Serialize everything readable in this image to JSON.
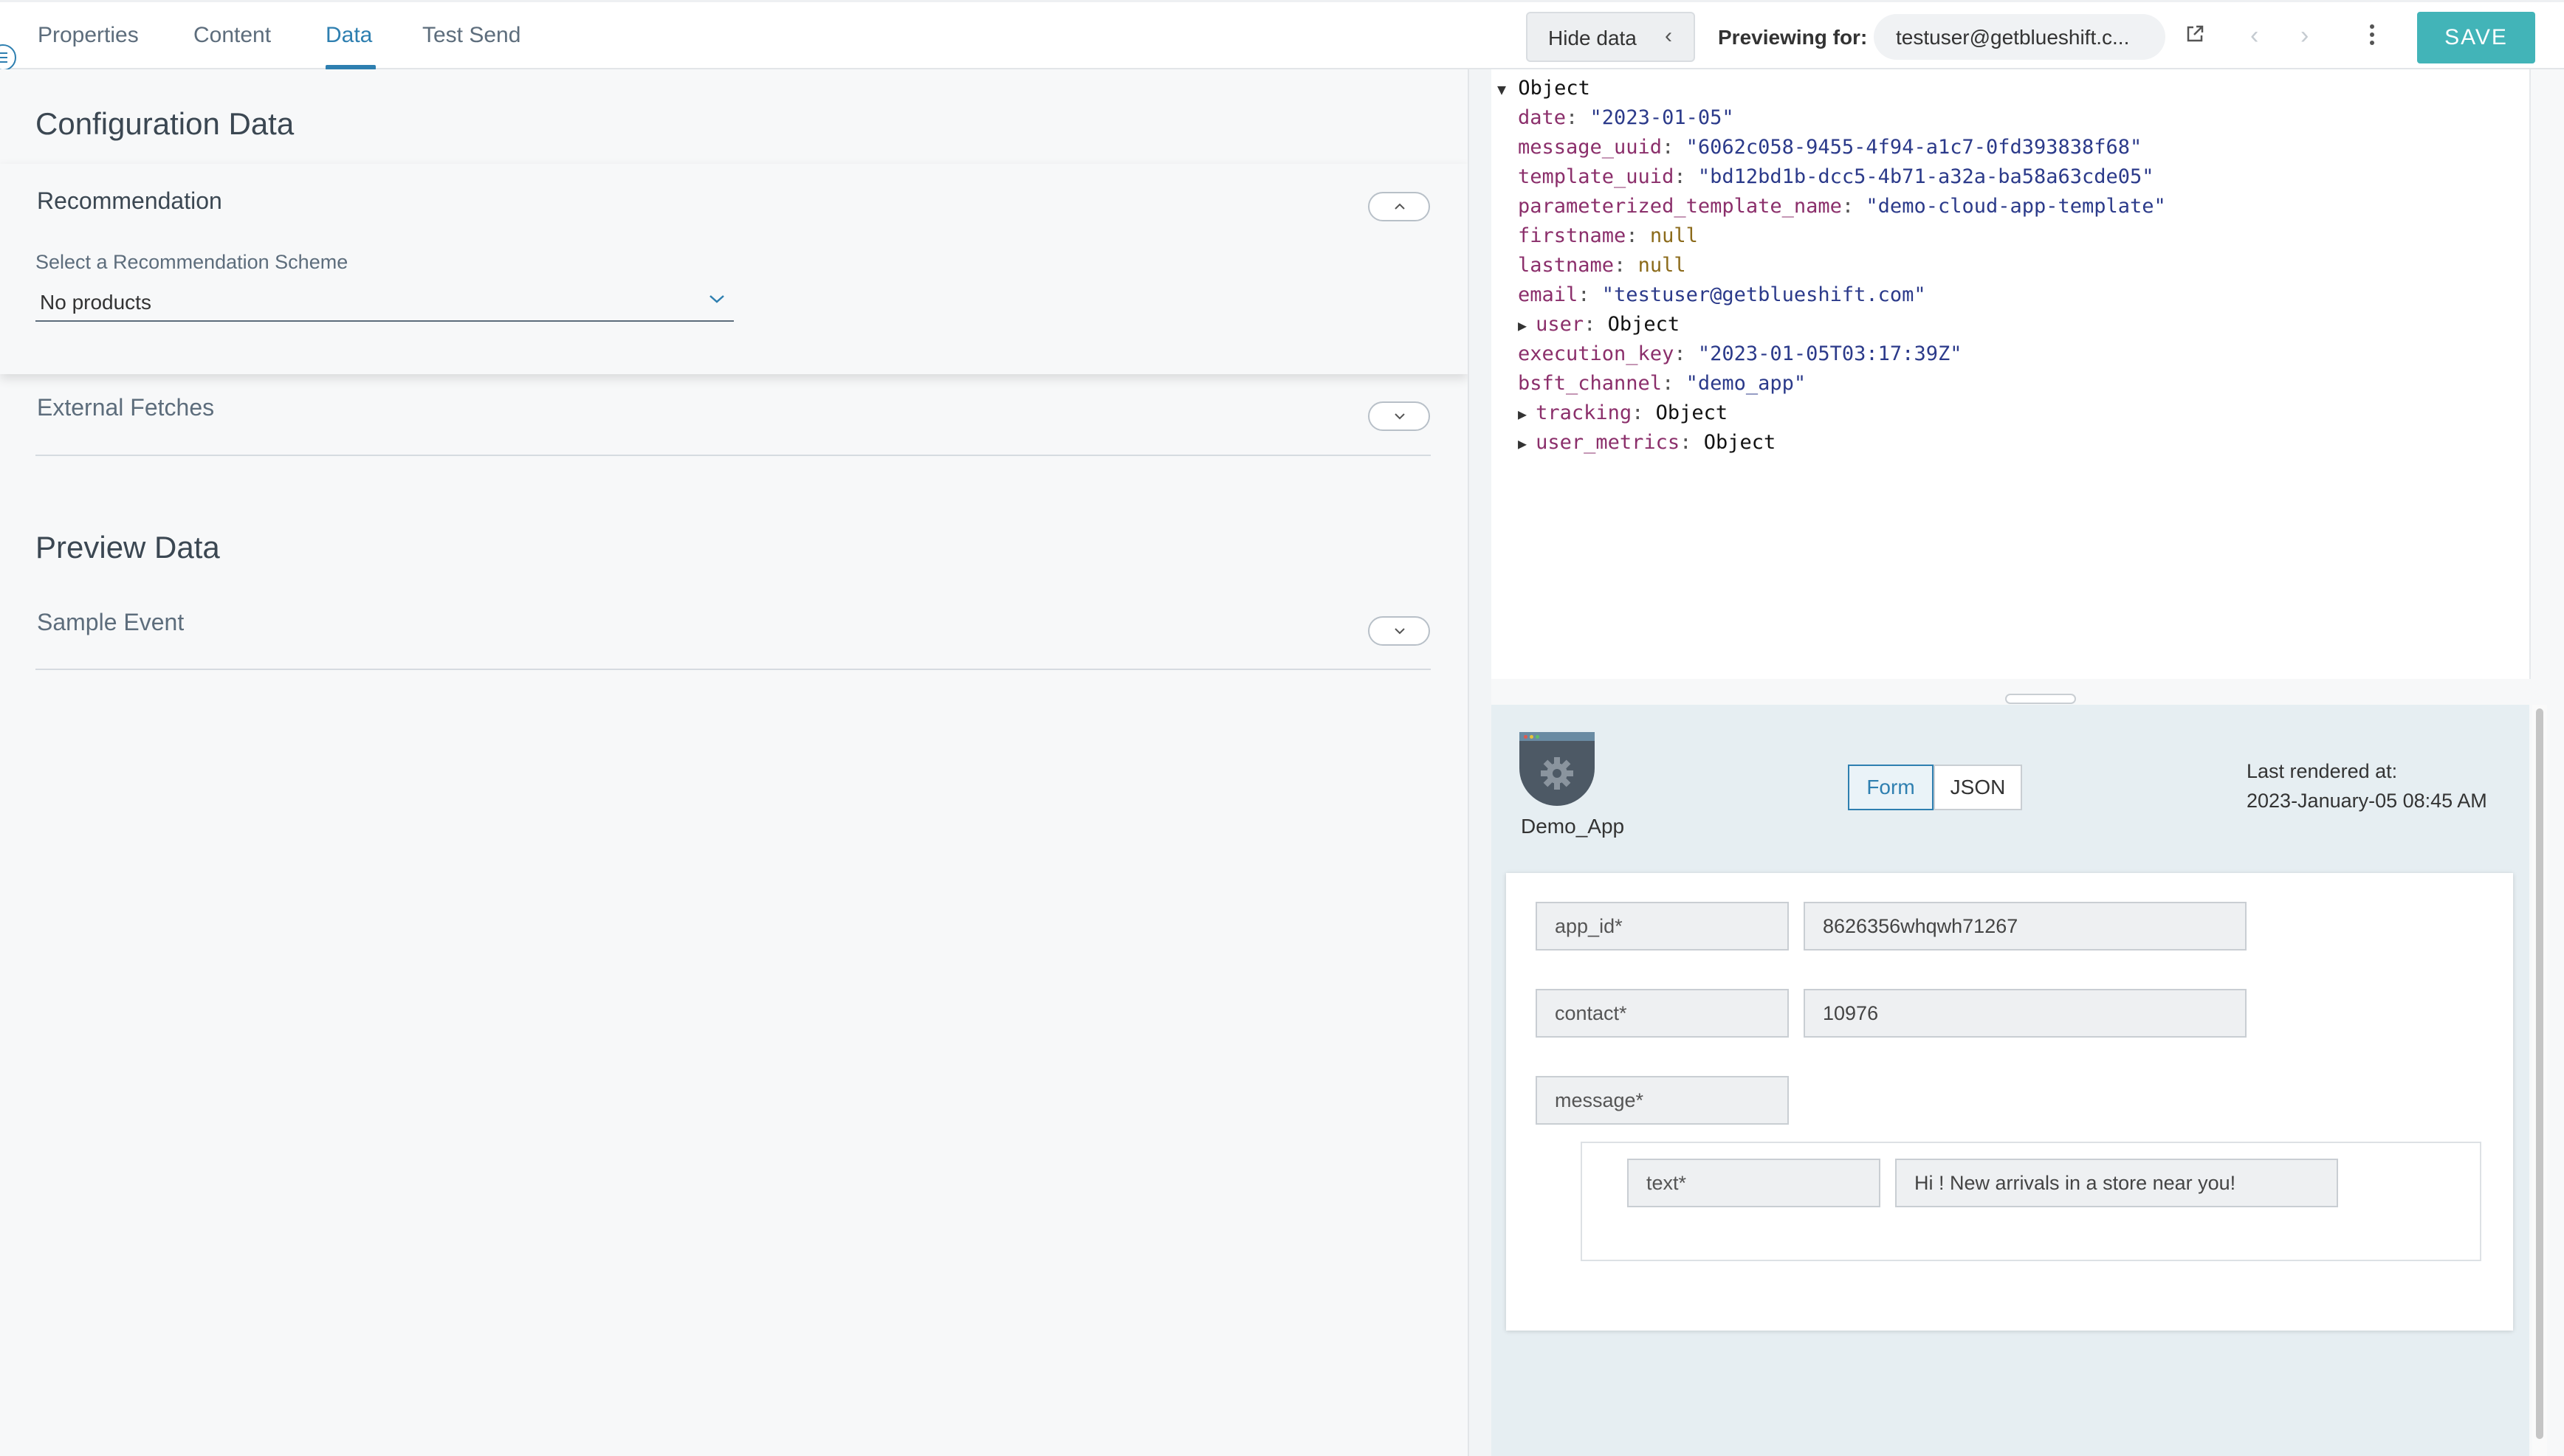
{
  "tabs": [
    {
      "label": "Properties"
    },
    {
      "label": "Content"
    },
    {
      "label": "Data"
    },
    {
      "label": "Test Send"
    }
  ],
  "header": {
    "hide_data_label": "Hide data",
    "previewing_label": "Previewing for:",
    "previewing_value": "testuser@getblueshift.c...",
    "save_label": "SAVE"
  },
  "left": {
    "config_title": "Configuration Data",
    "recommendation_title": "Recommendation",
    "scheme_label": "Select a Recommendation Scheme",
    "scheme_value": "No products",
    "external_fetches_title": "External Fetches",
    "preview_title": "Preview Data",
    "sample_event_title": "Sample Event"
  },
  "json_view": {
    "root": "Object",
    "lines": [
      {
        "key": "date",
        "value": "\"2023-01-05\"",
        "kind": "str"
      },
      {
        "key": "message_uuid",
        "value": "\"6062c058-9455-4f94-a1c7-0fd393838f68\"",
        "kind": "str"
      },
      {
        "key": "template_uuid",
        "value": "\"bd12bd1b-dcc5-4b71-a32a-ba58a63cde05\"",
        "kind": "str"
      },
      {
        "key": "parameterized_template_name",
        "value": "\"demo-cloud-app-template\"",
        "kind": "str"
      },
      {
        "key": "firstname",
        "value": "null",
        "kind": "null"
      },
      {
        "key": "lastname",
        "value": "null",
        "kind": "null"
      },
      {
        "key": "email",
        "value": "\"testuser@getblueshift.com\"",
        "kind": "str"
      },
      {
        "key": "user",
        "value": "Object",
        "kind": "obj"
      },
      {
        "key": "execution_key",
        "value": "\"2023-01-05T03:17:39Z\"",
        "kind": "str"
      },
      {
        "key": "bsft_channel",
        "value": "\"demo_app\"",
        "kind": "str"
      },
      {
        "key": "tracking",
        "value": "Object",
        "kind": "obj"
      },
      {
        "key": "user_metrics",
        "value": "Object",
        "kind": "obj"
      }
    ]
  },
  "render": {
    "app_name": "Demo_App",
    "form_label": "Form",
    "json_label": "JSON",
    "last_rendered_label": "Last rendered at:",
    "last_rendered_value": "2023-January-05 08:45 AM",
    "fields": {
      "app_id_label": "app_id*",
      "app_id_value": "8626356whqwh71267",
      "contact_label": "contact*",
      "contact_value": "10976",
      "message_label": "message*",
      "text_label": "text*",
      "text_value": "Hi ! New arrivals in a store near you!"
    }
  }
}
